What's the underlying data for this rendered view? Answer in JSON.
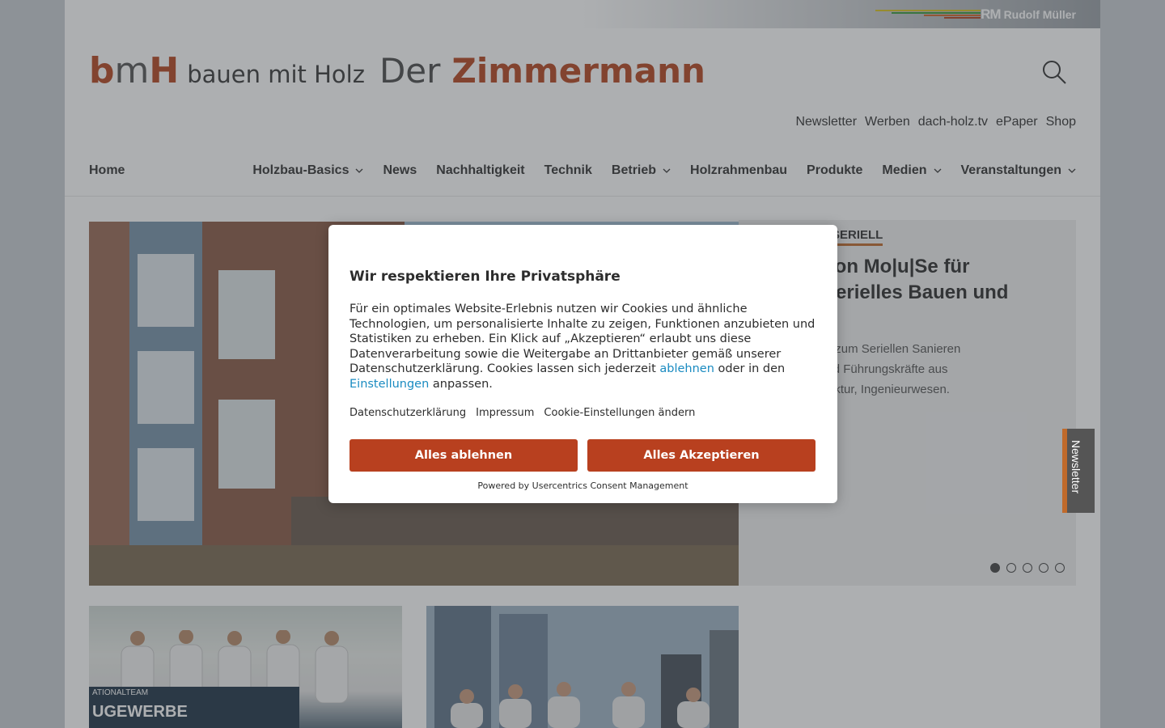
{
  "header": {
    "publisher": "Rudolf Müller",
    "publisher_mark": "RM",
    "publisher_line_colors": [
      "#d9c21f",
      "#3c9b3a",
      "#d2642a",
      "#b5451f"
    ],
    "logo_bmh": {
      "b": "b",
      "m": "m",
      "h": "H"
    },
    "logo_sub": "bauen mit Holz",
    "logo_der": "Der",
    "logo_zm": "Zimmermann",
    "accent_color": "#b5451f"
  },
  "utility_links": [
    "Newsletter",
    "Werben",
    "dach-holz.tv",
    "ePaper",
    "Shop"
  ],
  "nav": {
    "home": "Home",
    "items": [
      {
        "label": "Holzbau-Basics",
        "dropdown": true
      },
      {
        "label": "News",
        "dropdown": false
      },
      {
        "label": "Nachhaltigkeit",
        "dropdown": false
      },
      {
        "label": "Technik",
        "dropdown": false
      },
      {
        "label": "Betrieb",
        "dropdown": true
      },
      {
        "label": "Holzrahmenbau",
        "dropdown": false
      },
      {
        "label": "Produkte",
        "dropdown": false
      },
      {
        "label": "Medien",
        "dropdown": true
      },
      {
        "label": "Veranstaltungen",
        "dropdown": true
      }
    ]
  },
  "hero": {
    "category": "SERIELL",
    "title": "...gebote von Mo|u|Se für ...es und Serielles Bauen und",
    "title_lines": [
      "gebote von Mo|u|Se für",
      "es und Serielles Bauen und"
    ],
    "desc_lines": [
      "ungsangebote zum Seriellen Sanieren",
      "a. an Fach- und Führungskräfte aus",
      "tschaft, Architektur, Ingenieurwesen."
    ],
    "slides_total": 5,
    "active_slide": 1
  },
  "card1": {
    "banner": "UGEWERBE",
    "banner_prefix": "ATIONALTEAM"
  },
  "newsletter_tab": "Newsletter",
  "consent": {
    "title": "Wir respektieren Ihre Privatsphäre",
    "body_before": "Für ein optimales Website-Erlebnis nutzen wir Cookies und ähnliche Technologien, um personalisierte Inhalte zu zeigen, Funktionen anzubieten und Statistiken zu erheben. Ein Klick auf „Akzeptieren“ erlaubt uns diese Datenverarbeitung sowie die Weitergabe an Drittanbieter gemäß unserer Datenschutzerklärung. Cookies lassen sich jederzeit ",
    "link_decline": "ablehnen",
    "body_middle": " oder in den ",
    "link_settings": "Einstellungen",
    "body_after": " anpassen.",
    "links": [
      "Datenschutzerklärung",
      "Impressum",
      "Cookie-Einstellungen ändern"
    ],
    "reject_label": "Alles ablehnen",
    "accept_label": "Alles Akzeptieren",
    "powered": "Powered by Usercentrics Consent Management",
    "button_color": "#b8401f",
    "link_color": "#1a8bc1"
  }
}
